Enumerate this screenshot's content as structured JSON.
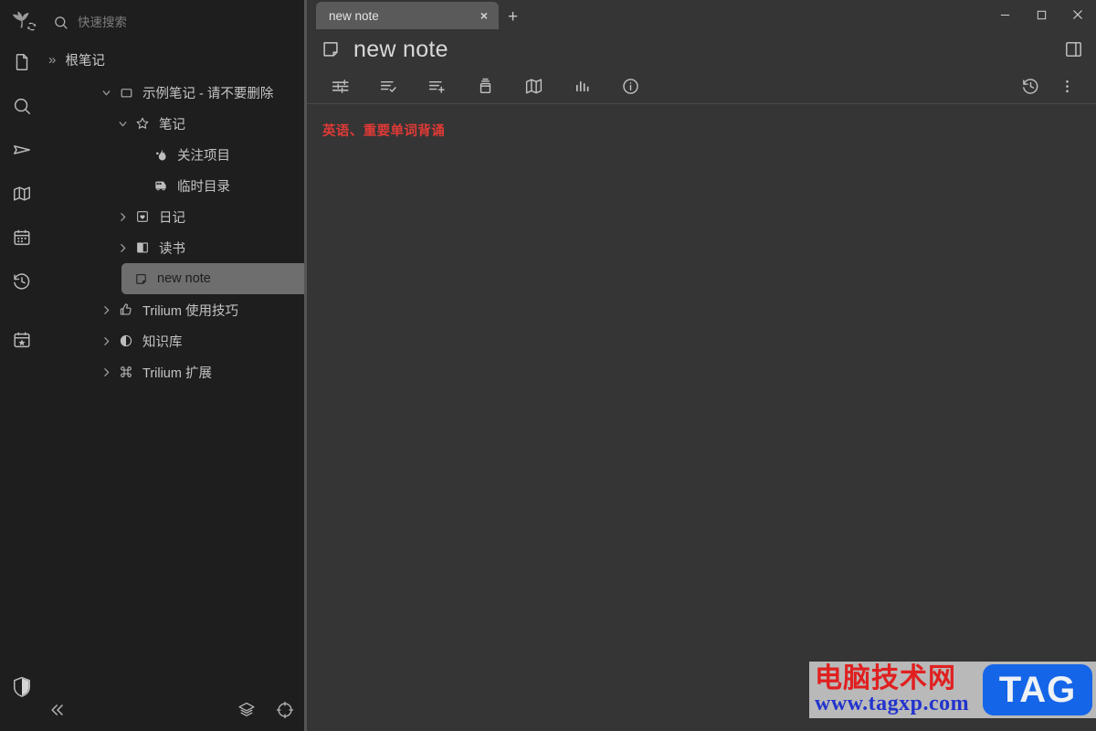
{
  "app": {
    "logo_icon": "trilium-leaf-logo",
    "sync_badge_icon": "sync-icon"
  },
  "rail": {
    "items": [
      {
        "icon": "note-icon",
        "name": "rail-item-notes"
      },
      {
        "icon": "search-icon",
        "name": "rail-item-search"
      },
      {
        "icon": "send-icon",
        "name": "rail-item-jump-to"
      },
      {
        "icon": "map-icon",
        "name": "rail-item-note-map"
      },
      {
        "icon": "calendar-icon",
        "name": "rail-item-calendar"
      },
      {
        "icon": "history-icon",
        "name": "rail-item-recent-changes"
      },
      {
        "icon": "calendar-star-icon",
        "name": "rail-item-today"
      }
    ],
    "shield_icon": "shield-icon"
  },
  "search": {
    "placeholder": "快速搜索",
    "icon": "search-icon"
  },
  "root": {
    "label": "根笔记",
    "chevron": "»",
    "icon": "file-icon"
  },
  "tree": {
    "nodes": [
      {
        "label": "示例笔记 - 请不要删除",
        "icon": "folder-icon",
        "twisty": "down",
        "depth": 0,
        "selected": false
      },
      {
        "label": "笔记",
        "icon": "star-icon",
        "twisty": "down",
        "depth": 1,
        "selected": false
      },
      {
        "label": "关注项目",
        "icon": "flame-icon",
        "twisty": "none",
        "depth": 2,
        "selected": false
      },
      {
        "label": "临时目录",
        "icon": "bus-icon",
        "twisty": "none",
        "depth": 2,
        "selected": false
      },
      {
        "label": "日记",
        "icon": "book-heart-icon",
        "twisty": "right",
        "depth": 2,
        "selected": false
      },
      {
        "label": "读书",
        "icon": "open-book-icon",
        "twisty": "right",
        "depth": 2,
        "selected": false
      },
      {
        "label": "new note",
        "icon": "note-page-icon",
        "twisty": "none",
        "depth": 2,
        "selected": true
      },
      {
        "label": "Trilium 使用技巧",
        "icon": "thumbs-up-icon",
        "twisty": "right",
        "depth": 1,
        "selected": false
      },
      {
        "label": "知识库",
        "icon": "contrast-circle-icon",
        "twisty": "right",
        "depth": 1,
        "selected": false
      },
      {
        "label": "Trilium 扩展",
        "icon": "command-icon",
        "twisty": "right",
        "depth": 1,
        "selected": false
      }
    ]
  },
  "tree_bottom": {
    "collapse_icon": "chevrons-left-icon",
    "buttons": [
      {
        "icon": "layers-icon",
        "name": "layers-button"
      },
      {
        "icon": "crosshair-icon",
        "name": "crosshair-button"
      },
      {
        "icon": "gear-icon",
        "name": "settings-button"
      }
    ]
  },
  "tabs": {
    "items": [
      {
        "label": "new note",
        "active": true,
        "close_label": "×"
      }
    ],
    "new_tab_label": "+"
  },
  "window_controls": {
    "minimize": "−",
    "maximize": "□",
    "close": "×"
  },
  "note": {
    "icon": "note-page-icon",
    "title": "new note",
    "panel_toggle_icon": "panel-right-icon",
    "content_lines": [
      "英语、重要单词背诵"
    ],
    "content_color": "#e03a36"
  },
  "note_toolbar": {
    "left_buttons": [
      {
        "icon": "sliders-icon",
        "name": "note-attributes-button"
      },
      {
        "icon": "list-check-icon",
        "name": "note-todo-button"
      },
      {
        "icon": "list-plus-icon",
        "name": "note-add-list-button"
      },
      {
        "icon": "archive-icon",
        "name": "note-archive-button"
      },
      {
        "icon": "map-book-icon",
        "name": "note-map-button"
      },
      {
        "icon": "bar-chart-icon",
        "name": "note-stats-button"
      },
      {
        "icon": "info-icon",
        "name": "note-info-button"
      }
    ],
    "right_buttons": [
      {
        "icon": "history-icon",
        "name": "note-revisions-button"
      },
      {
        "icon": "more-vertical-icon",
        "name": "note-more-menu-button"
      }
    ]
  },
  "watermark": {
    "title_cn": "电脑技术网",
    "url": "www.tagxp.com",
    "badge": "TAG"
  },
  "colors": {
    "sidebar_bg": "#1e1e1e",
    "main_bg": "#353535",
    "tab_active_bg": "#5a5a5a",
    "selected_node_bg": "#6e6e6e",
    "divider": "#555555",
    "accent_red": "#e03a36",
    "watermark_blue": "#1565e8"
  }
}
